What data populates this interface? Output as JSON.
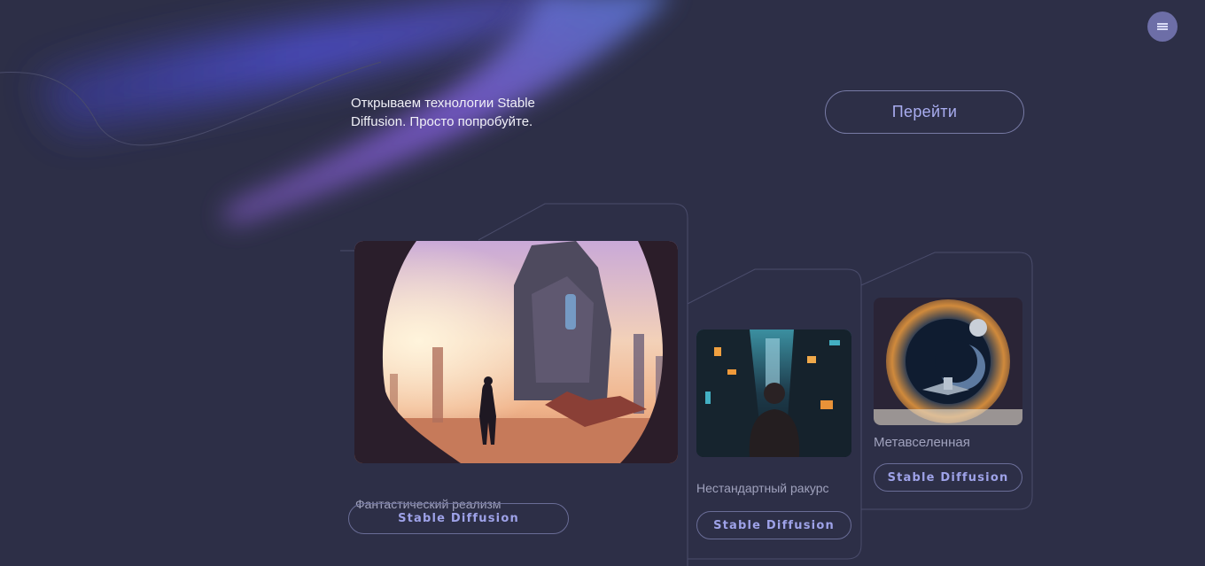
{
  "header": {
    "tagline": "Открываем технологии Stable Diffusion. Просто попробуйте.",
    "go_button": "Перейти",
    "menu_icon": "hamburger-menu-icon"
  },
  "cards": [
    {
      "label": "Фантастический реализм",
      "button": "Stable Diffusion",
      "image": "fantasy-realism-image"
    },
    {
      "label": "Нестандартный ракурс",
      "button": "Stable Diffusion",
      "image": "unusual-angle-image"
    },
    {
      "label": "Метавселенная",
      "button": "Stable Diffusion",
      "image": "metaverse-image"
    }
  ],
  "colors": {
    "background": "#2d2f47",
    "accent": "#a9adf0",
    "glow_blue": "#4b4ec8",
    "glow_purple": "#7a5cd6"
  }
}
